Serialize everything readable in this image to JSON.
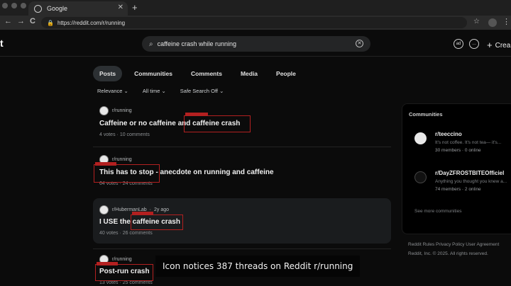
{
  "browser": {
    "tab_title": "Google",
    "tab_close": "✕",
    "new_tab": "+",
    "back": "←",
    "forward": "→",
    "reload": "C",
    "url": "https://reddit.com/r/running",
    "menu": "⋮"
  },
  "header": {
    "logo_fragment": "t",
    "search_query": "caffeine crash while running",
    "create_label": "Crea",
    "icons": [
      "ad-icon",
      "chat-icon",
      "plus-icon"
    ]
  },
  "search_tabs": [
    "Posts",
    "Communities",
    "Comments",
    "Media",
    "People"
  ],
  "filters": {
    "sort": "Relevance ⌄",
    "time": "All time ⌄",
    "safe": "Safe Search Off ⌄"
  },
  "posts": [
    {
      "subreddit": "r/running",
      "time": "",
      "title": "Caffeine or no caffeine and caffeine crash",
      "votes": "4 votes",
      "comments": "10 comments"
    },
    {
      "subreddit": "r/running",
      "time": "",
      "title": "This has to stop - anecdote on running and caffeine",
      "votes": "64 votes",
      "comments": "24 comments"
    },
    {
      "subreddit": "r/HubermanLab",
      "time": "2y ago",
      "title": "I USE the caffeine crash",
      "votes": "40 votes",
      "comments": "26 comments"
    },
    {
      "subreddit": "r/running",
      "time": "",
      "title": "Post-run crash",
      "votes": "13 votes",
      "comments": "25 comments"
    }
  ],
  "sidebar": {
    "heading": "Communities",
    "communities": [
      {
        "name": "r/teeccino",
        "desc": "It's not coffee. It's not tea— it's...",
        "stats": "30 members · 0 online"
      },
      {
        "name": "r/DayZFROSTBITEOfficiel",
        "desc": "Anything you thought you knew a...",
        "stats": "74 members · 2 online"
      }
    ],
    "see_more": "See more communities"
  },
  "footer": {
    "line1": "Reddit Rules  Privacy Policy  User Agreement",
    "line2": "Reddit, Inc. © 2025. All rights reserved."
  },
  "caption": "Icon notices 387 threads on Reddit r/running",
  "colors": {
    "highlight_box": "#b32020",
    "background": "#0b0b0b",
    "active_tab": "#2c3033"
  }
}
